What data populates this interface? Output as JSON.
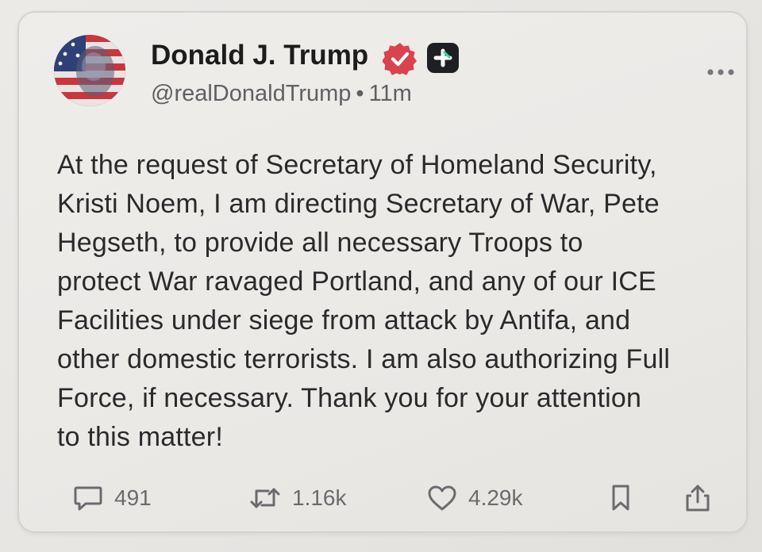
{
  "post": {
    "author": {
      "display_name": "Donald J. Trump",
      "handle": "@realDonaldTrump",
      "timestamp": "11m",
      "separator": "•",
      "verified_icon": "verified-badge-icon",
      "extra_badge_icon": "plus-badge-icon"
    },
    "body_lines": [
      "At the request of Secretary of Homeland Security,",
      "Kristi Noem, I am directing Secretary of War, Pete",
      "Hegseth, to provide all necessary Troops to",
      "protect War ravaged Portland, and any of our ICE",
      "Facilities under siege from attack by Antifa, and",
      "other domestic terrorists. I am also authorizing Full",
      "Force, if necessary. Thank you for your attention",
      "to this matter!"
    ],
    "actions": {
      "replies": {
        "icon": "reply-icon",
        "count": "491"
      },
      "retruths": {
        "icon": "repost-icon",
        "count": "1.16k"
      },
      "likes": {
        "icon": "heart-icon",
        "count": "4.29k"
      },
      "bookmark": {
        "icon": "bookmark-icon"
      },
      "share": {
        "icon": "share-icon"
      }
    },
    "menu_icon": "more-options-icon"
  },
  "colors": {
    "verified_badge": "#d9434e",
    "text_primary": "#1c1c1c",
    "text_secondary": "#5f6063",
    "icon_gray": "#6a6b6e"
  }
}
